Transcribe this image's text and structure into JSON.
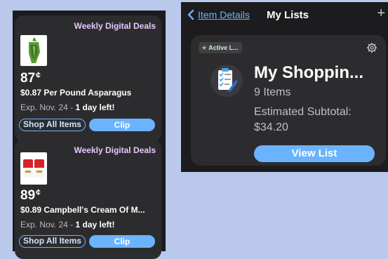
{
  "deals": [
    {
      "header": "Weekly Digital Deals",
      "price_whole": "87",
      "price_unit": "¢",
      "description": "$0.87 Per Pound Asparagus",
      "expiry_prefix": "Exp. Nov. 24 - ",
      "expiry_highlight": "1 day left!",
      "shop_label": "Shop All Items",
      "clip_label": "Clip",
      "product_icon": "asparagus-icon"
    },
    {
      "header": "Weekly Digital Deals",
      "price_whole": "89",
      "price_unit": "¢",
      "description": "$0.89 Campbell's Cream Of M...",
      "expiry_prefix": "Exp. Nov. 24 - ",
      "expiry_highlight": "1 day left!",
      "shop_label": "Shop All Items",
      "clip_label": "Clip",
      "product_icon": "soup-can-icon"
    }
  ],
  "lists_panel": {
    "back_label": "Item Details",
    "title": "My Lists",
    "add_icon": "plus-icon",
    "card": {
      "badge": "Active L...",
      "name": "My Shoppin...",
      "count": "9 Items",
      "subtotal_label": "Estimated Subtotal:",
      "subtotal_value": "$34.20",
      "view_label": "View List"
    }
  },
  "colors": {
    "background": "#b9c8eb",
    "panel": "#1c1c1e",
    "card": "#2c2c2e",
    "accent": "#6bb3ff",
    "deal_header": "#e9c6ff"
  }
}
